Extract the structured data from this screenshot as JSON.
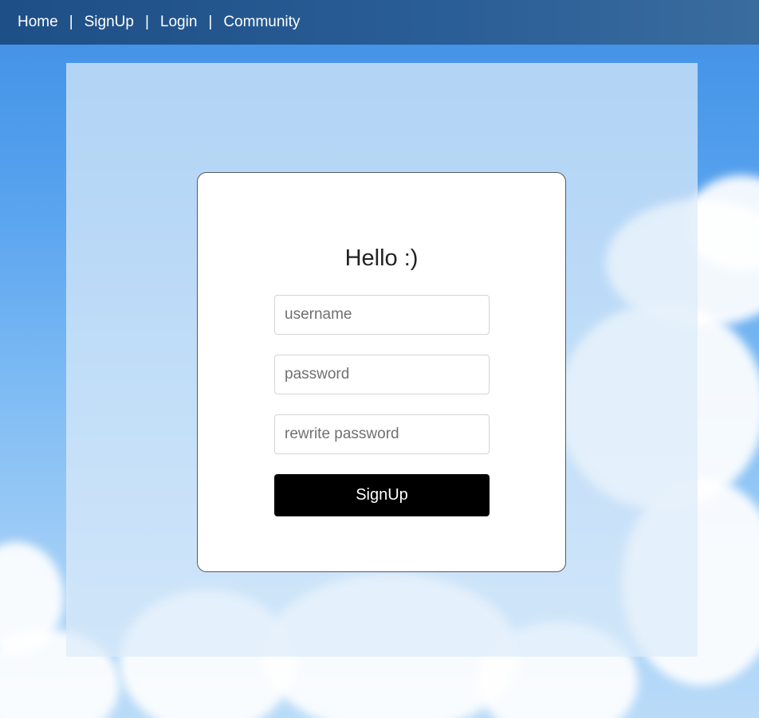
{
  "nav": {
    "items": [
      {
        "label": "Home"
      },
      {
        "label": "SignUp"
      },
      {
        "label": "Login"
      },
      {
        "label": "Community"
      }
    ],
    "separator": "|"
  },
  "form": {
    "title": "Hello :)",
    "username": {
      "value": "",
      "placeholder": "username"
    },
    "password": {
      "value": "",
      "placeholder": "password"
    },
    "rewrite_password": {
      "value": "",
      "placeholder": "rewrite password"
    },
    "submit_label": "SignUp"
  },
  "colors": {
    "navbar": "#24558c",
    "submit_button": "#000000",
    "card_border": "#555a60"
  }
}
